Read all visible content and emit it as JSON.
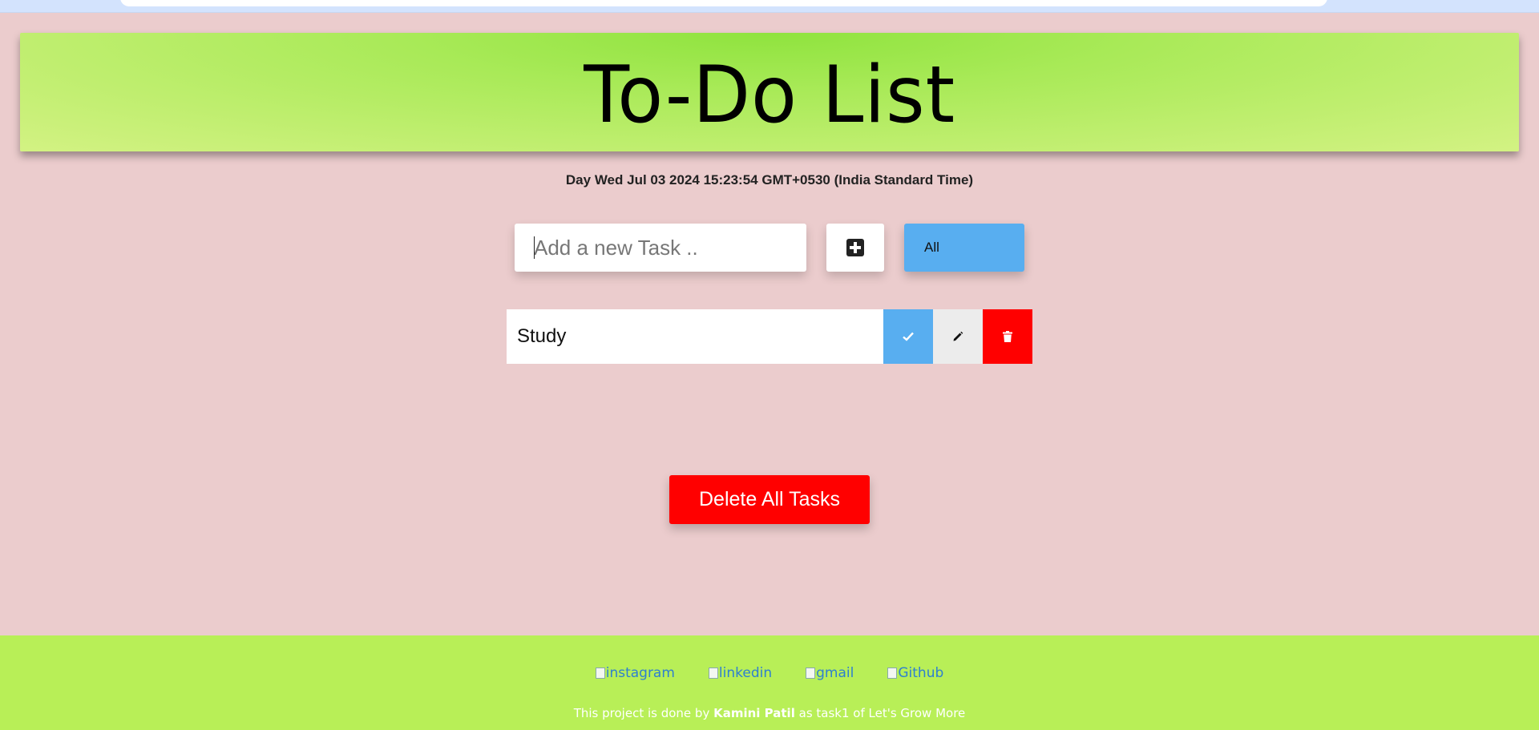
{
  "header": {
    "title": "To-Do List"
  },
  "datetime": {
    "text": "Day Wed Jul 03 2024 15:23:54 GMT+0530 (India Standard Time)"
  },
  "task_input": {
    "placeholder": "Add a new Task ..",
    "value": ""
  },
  "add_button": {
    "icon": "plus-square-icon"
  },
  "filter": {
    "selected": "All"
  },
  "tasks": [
    {
      "text": "Study",
      "done_icon": "check-icon",
      "edit_icon": "pencil-icon",
      "delete_icon": "trash-icon"
    }
  ],
  "delete_all_label": "Delete All Tasks",
  "footer": {
    "links": [
      {
        "alt": "instagram"
      },
      {
        "alt": "linkedin"
      },
      {
        "alt": "gmail"
      },
      {
        "alt": "Github"
      }
    ],
    "credit_prefix": "This project is done by",
    "credit_name": "Kamini Patil",
    "credit_suffix": "as task1 of Let's Grow More"
  },
  "colors": {
    "background": "#ebcccd",
    "header_green": "#9ee84f",
    "accent_blue": "#58aef0",
    "danger_red": "#ff0000",
    "footer_green": "#b8ef57"
  }
}
